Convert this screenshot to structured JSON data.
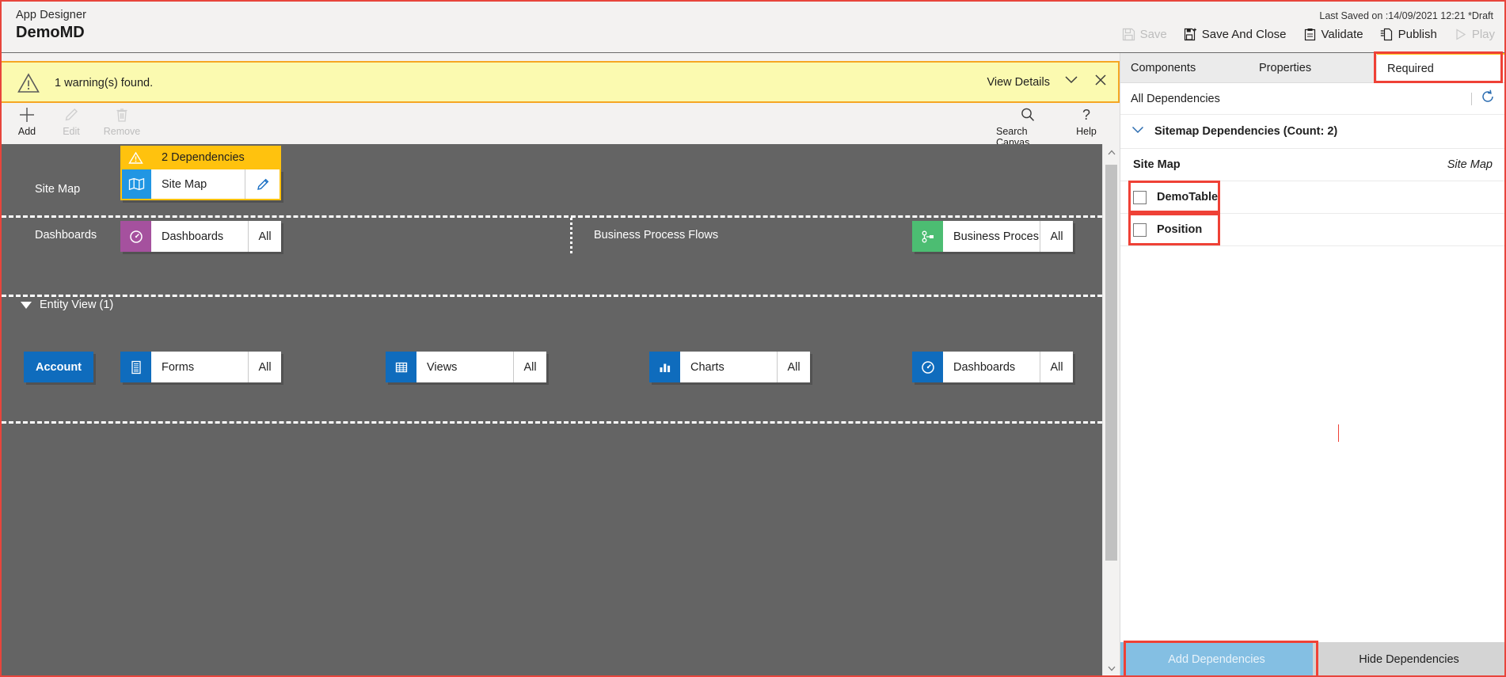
{
  "header": {
    "app_label": "App Designer",
    "app_name": "DemoMD",
    "last_saved": "Last Saved on :14/09/2021 12:21 *Draft",
    "actions": [
      {
        "label": "Save",
        "icon": "save-icon",
        "disabled": true
      },
      {
        "label": "Save And Close",
        "icon": "save-and-close-icon",
        "disabled": false
      },
      {
        "label": "Validate",
        "icon": "validate-icon",
        "disabled": false
      },
      {
        "label": "Publish",
        "icon": "publish-icon",
        "disabled": false
      },
      {
        "label": "Play",
        "icon": "play-icon",
        "disabled": true
      }
    ]
  },
  "warning": {
    "icon": "warning-triangle-icon",
    "text": "1 warning(s) found.",
    "view_details": "View Details",
    "chevron_icon": "chevron-down-icon",
    "close_icon": "close-icon",
    "background": "#fbfab0",
    "border": "#f5a623"
  },
  "toolbar": {
    "items": [
      {
        "label": "Add",
        "icon": "plus-icon",
        "disabled": false
      },
      {
        "label": "Edit",
        "icon": "pencil-icon",
        "disabled": true
      },
      {
        "label": "Remove",
        "icon": "trash-icon",
        "disabled": true
      }
    ],
    "right_items": [
      {
        "label": "Search Canvas",
        "icon": "search-icon",
        "disabled": false
      },
      {
        "label": "Help",
        "icon": "question-icon",
        "disabled": false
      }
    ]
  },
  "canvas": {
    "background": "#646464",
    "sitemap_row": {
      "label": "Site Map",
      "dependency_banner": {
        "icon": "warning-triangle-icon",
        "text": "2 Dependencies",
        "color": "#ffc20e"
      },
      "tile": {
        "icon": "sitemap-icon",
        "icon_color": "#2196e3",
        "name": "Site Map",
        "edit_icon": "pencil-icon"
      }
    },
    "dashboards_row": {
      "label": "Dashboards",
      "tile": {
        "icon": "dashboard-icon",
        "icon_color": "#a5519e",
        "name": "Dashboards",
        "scope": "All"
      }
    },
    "bpf_row": {
      "label": "Business Process Flows",
      "tile": {
        "icon": "bpf-icon",
        "icon_color": "#4cbd72",
        "name": "Business Proces...",
        "scope": "All"
      }
    },
    "entity_view": {
      "header": "Entity View (1)",
      "caret_icon": "caret-down-icon",
      "entity_pill": "Account",
      "tiles": [
        {
          "icon": "forms-icon",
          "icon_color": "#0f6cbd",
          "name": "Forms",
          "scope": "All"
        },
        {
          "icon": "views-icon",
          "icon_color": "#0f6cbd",
          "name": "Views",
          "scope": "All"
        },
        {
          "icon": "charts-icon",
          "icon_color": "#0f6cbd",
          "name": "Charts",
          "scope": "All"
        },
        {
          "icon": "dashboard-icon",
          "icon_color": "#0f6cbd",
          "name": "Dashboards",
          "scope": "All"
        }
      ]
    }
  },
  "scrollbar": {
    "up_icon": "scroll-up-arrow-icon",
    "down_icon": "scroll-down-arrow-icon"
  },
  "right_panel": {
    "tabs": [
      {
        "label": "Components",
        "active": false
      },
      {
        "label": "Properties",
        "active": false
      },
      {
        "label": "Required",
        "active": true,
        "highlighted": true
      }
    ],
    "all_dependencies_label": "All Dependencies",
    "refresh_icon": "refresh-icon",
    "group": {
      "label": "Sitemap Dependencies (Count: 2)",
      "chevron_icon": "chevron-down-icon",
      "expanded": true
    },
    "table": {
      "header_left": "Site Map",
      "header_right": "Site Map",
      "rows": [
        {
          "label": "DemoTable",
          "checked": false,
          "highlighted": true
        },
        {
          "label": "Position",
          "checked": false,
          "highlighted": true
        }
      ]
    },
    "footer": {
      "add_dependencies": "Add Dependencies",
      "add_dependencies_disabled": true,
      "add_dependencies_highlighted": true,
      "hide_dependencies": "Hide Dependencies"
    }
  },
  "annotation_color": "#ef4136"
}
